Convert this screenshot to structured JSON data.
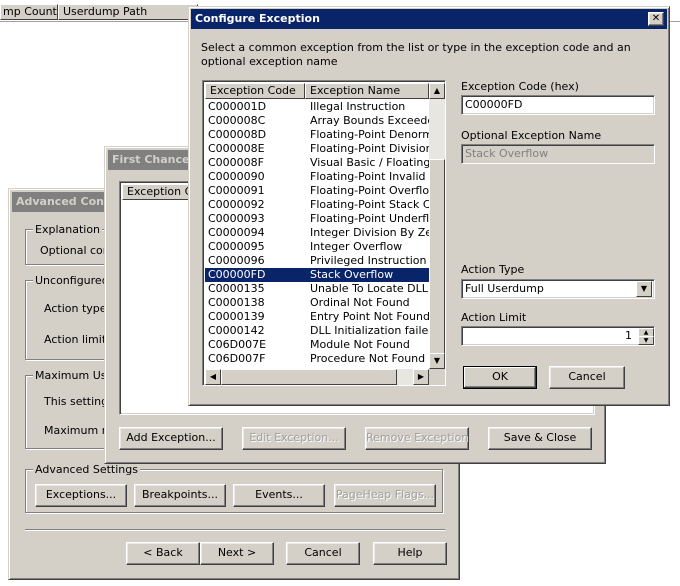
{
  "background_window": {
    "columns": [
      "mp Count",
      "Userdump Path"
    ]
  },
  "advanced_config": {
    "title": "Advanced Configu",
    "explanation_group": "Explanation",
    "explanation_text": "Optional confi",
    "unconfigured_group": "Unconfigured F",
    "action_type_label": "Action type fo",
    "action_limit_label": "Action limit fo",
    "maximum_group": "Maximum User",
    "setting_text": "This setting is",
    "maximum_num_text": "Maximum nur",
    "advanced_settings_group": "Advanced Settings",
    "buttons": {
      "exceptions": "Exceptions...",
      "breakpoints": "Breakpoints...",
      "events": "Events...",
      "pageheap": "PageHeap Flags..."
    },
    "nav": {
      "back": "< Back",
      "next": "Next >",
      "cancel": "Cancel",
      "help": "Help"
    }
  },
  "first_chance": {
    "title": "First Chance E",
    "column": "Exception Co",
    "buttons": {
      "add": "Add Exception...",
      "edit": "Edit Exception...",
      "remove": "Remove Exception",
      "save_close": "Save & Close"
    }
  },
  "configure_exception": {
    "title": "Configure Exception",
    "close_glyph": "✕",
    "instructions": "Select a common exception from the list or type in the exception code and an optional exception name",
    "list_headers": [
      "Exception Code",
      "Exception Name"
    ],
    "rows": [
      {
        "code": "C000001D",
        "name": "Illegal Instruction"
      },
      {
        "code": "C000008C",
        "name": "Array Bounds Exceeded"
      },
      {
        "code": "C000008D",
        "name": "Floating-Point Denormal O"
      },
      {
        "code": "C000008E",
        "name": "Floating-Point Division By"
      },
      {
        "code": "C000008F",
        "name": "Visual Basic / Floating-Poi"
      },
      {
        "code": "C0000090",
        "name": "Floating-Point Invalid Ope"
      },
      {
        "code": "C0000091",
        "name": "Floating-Point Overflow"
      },
      {
        "code": "C0000092",
        "name": "Floating-Point Stack Chec"
      },
      {
        "code": "C0000093",
        "name": "Floating-Point Underflow"
      },
      {
        "code": "C0000094",
        "name": "Integer Division By Zero"
      },
      {
        "code": "C0000095",
        "name": "Integer Overflow"
      },
      {
        "code": "C0000096",
        "name": "Privileged Instruction"
      },
      {
        "code": "C00000FD",
        "name": "Stack Overflow"
      },
      {
        "code": "C0000135",
        "name": "Unable To Locate DLL"
      },
      {
        "code": "C0000138",
        "name": "Ordinal Not Found"
      },
      {
        "code": "C0000139",
        "name": "Entry Point Not Found"
      },
      {
        "code": "C0000142",
        "name": "DLL Initialization failed"
      },
      {
        "code": "C06D007E",
        "name": "Module Not Found"
      },
      {
        "code": "C06D007F",
        "name": "Procedure Not Found"
      }
    ],
    "selected_index": 12,
    "exception_code_label": "Exception Code (hex)",
    "exception_code_value": "C00000FD",
    "optional_name_label": "Optional Exception Name",
    "optional_name_value": "Stack Overflow",
    "action_type_label": "Action Type",
    "action_type_value": "Full Userdump",
    "action_limit_label": "Action Limit",
    "action_limit_value": "1",
    "ok": "OK",
    "cancel": "Cancel"
  },
  "colors": {
    "dialog_face": "#d4d0c8",
    "active_title": "#0a246a",
    "inactive_title": "#808080",
    "selection": "#0a246a"
  }
}
